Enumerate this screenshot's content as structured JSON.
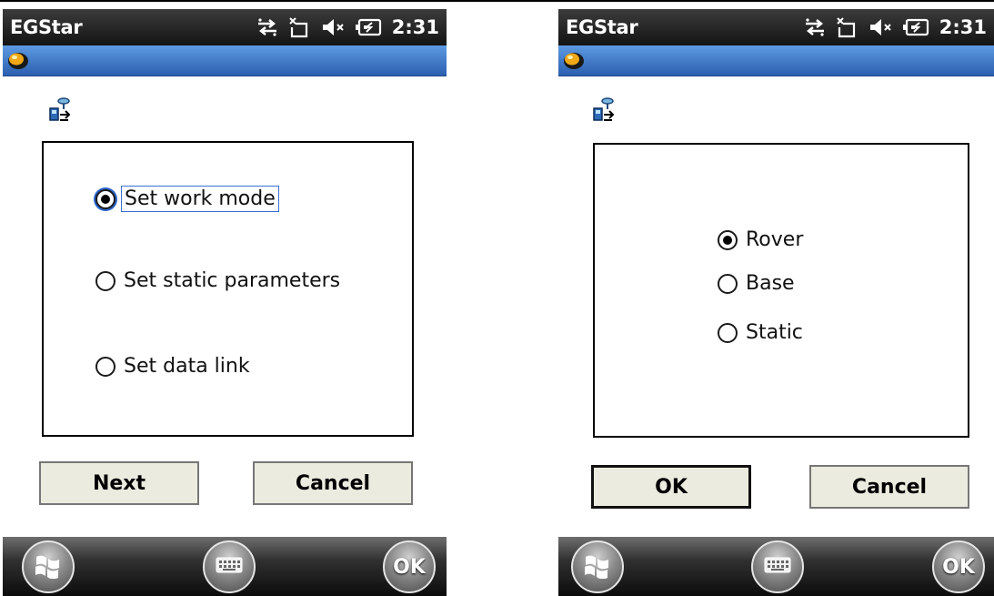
{
  "status_bar": {
    "app_title": "EGStar",
    "time": "2:31",
    "icons": [
      "sync-arrows-icon",
      "sim-card-off-icon",
      "volume-muted-icon",
      "battery-charging-icon"
    ]
  },
  "left_screen": {
    "options": [
      {
        "label": "Set work mode",
        "checked": true
      },
      {
        "label": "Set static parameters",
        "checked": false
      },
      {
        "label": "Set data link",
        "checked": false
      }
    ],
    "buttons": {
      "next": "Next",
      "cancel": "Cancel"
    }
  },
  "right_screen": {
    "options": [
      {
        "label": "Rover",
        "checked": true
      },
      {
        "label": "Base",
        "checked": false
      },
      {
        "label": "Static",
        "checked": false
      }
    ],
    "buttons": {
      "ok": "OK",
      "cancel": "Cancel"
    }
  },
  "taskbar": {
    "start_icon": "windows-logo-icon",
    "keyboard_icon": "keyboard-icon",
    "ok_label": "OK"
  }
}
